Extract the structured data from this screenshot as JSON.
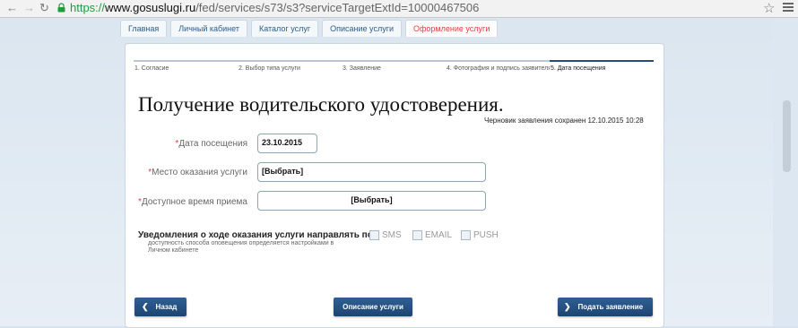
{
  "browser": {
    "url_scheme": "https://",
    "url_host": "www.gosuslugi.ru",
    "url_path": "/fed/services/s73/s3?serviceTargetExtId=10000467506"
  },
  "tabs": [
    {
      "label": "Главная"
    },
    {
      "label": "Личный кабинет"
    },
    {
      "label": "Каталог услуг"
    },
    {
      "label": "Описание услуги"
    },
    {
      "label": "Оформление услуги",
      "active": true
    }
  ],
  "steps": [
    {
      "label": "1. Согласие"
    },
    {
      "label": "2. Выбор типа услуги"
    },
    {
      "label": "3. Заявление"
    },
    {
      "label": "4. Фотография и подпись заявителя"
    },
    {
      "label": "5. Дата посещения",
      "active": true
    }
  ],
  "page": {
    "title": "Получение водительского удостоверения.",
    "draft_status": "Черновик заявления сохранен 12.10.2015 10:28"
  },
  "form": {
    "required_mark": "*",
    "visit_date": {
      "label": "Дата посещения",
      "value": "23.10.2015"
    },
    "service_place": {
      "label": "Место оказания услуги",
      "value": "[Выбрать]"
    },
    "available_time": {
      "label": "Доступное время приема",
      "value": "[Выбрать]"
    }
  },
  "notifications": {
    "label": "Уведомления о ходе оказания услуги направлять по:",
    "note": "доступность способа оповещения определяется настройками в Личном кабинете",
    "options": [
      {
        "label": "SMS",
        "checked": false
      },
      {
        "label": "EMAIL",
        "checked": false
      },
      {
        "label": "PUSH",
        "checked": false
      }
    ]
  },
  "buttons": {
    "back": "Назад",
    "description": "Описание услуги",
    "submit": "Подать заявление"
  },
  "icons": {
    "back": "back-arrow-icon",
    "forward": "forward-arrow-icon",
    "reload": "reload-icon",
    "lock": "lock-icon",
    "star": "star-icon",
    "menu": "menu-icon"
  },
  "colors": {
    "primary_button": "#1d4573",
    "active_tab": "#e04040",
    "required": "#e04040",
    "url_secure": "#1e9d3a"
  }
}
